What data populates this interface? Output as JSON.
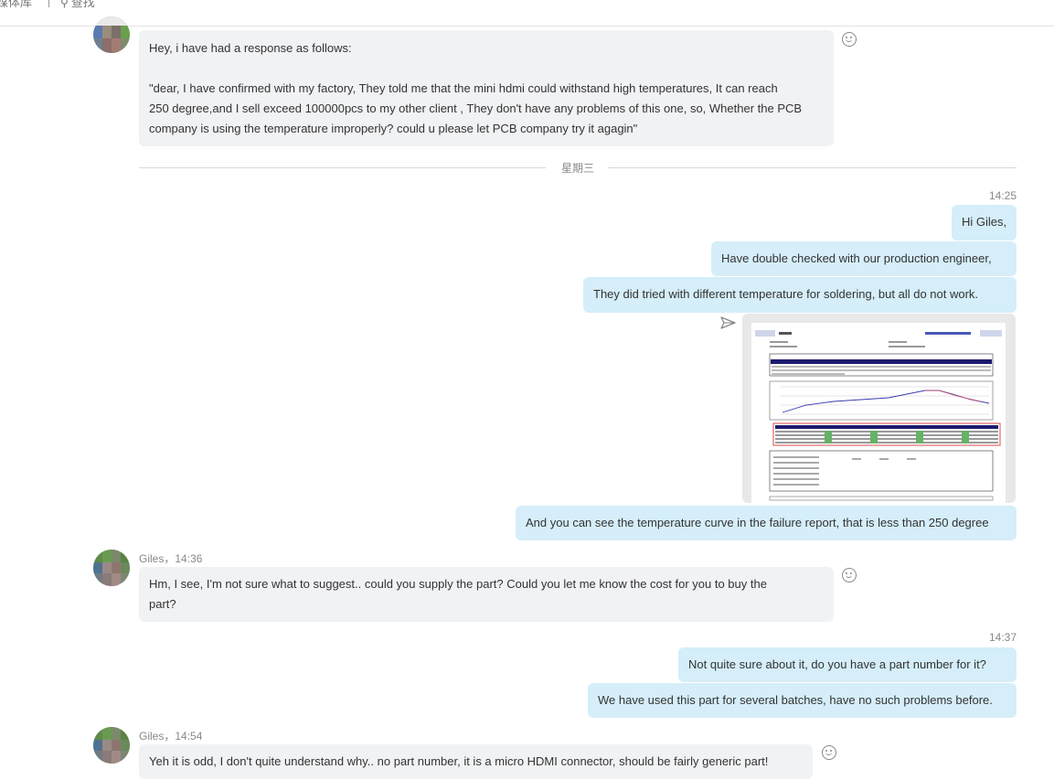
{
  "topbar": {
    "media_label": "媒体库",
    "search_label": "查找"
  },
  "day_divider": "星期三",
  "messages": {
    "m1": {
      "p1": "Hey, i have had a response as follows:",
      "l1": "\"dear, I have confirmed with my factory, They told me that the mini hdmi could withstand high temperatures, It can reach",
      "l2": "250 degree,and I sell exceed 100000pcs to my other client , They don't have any problems of this one, so, Whether the PCB",
      "l3": "company is using the temperature improperly? could u please let PCB company try it agagin\""
    },
    "t1": "14:25",
    "o1": "Hi Giles,",
    "o2": "Have double checked with our production engineer,",
    "o3": "They did tried with different temperature for soldering, but all do not work.",
    "o4": "And you can see the temperature curve in the failure report, that is less than 250 degree",
    "s1": "Giles，14:36",
    "m2": {
      "l1": "Hm, I see, I'm not sure what to suggest.. could you supply the part? Could you let me know the cost for you to buy the",
      "l2": "part?"
    },
    "t2": "14:37",
    "o5": "Not quite sure about it, do you have a part number for it?",
    "o6": "We have used this part for several batches, have no such problems before.",
    "s2": "Giles，14:54",
    "m3": "Yeh it is odd, I don't quite understand why.. no part number, it is a micro HDMI connector, should be fairly generic part!"
  },
  "colors": {
    "incoming_bubble": "#f1f2f4",
    "outgoing_bubble": "#d5eef9"
  }
}
